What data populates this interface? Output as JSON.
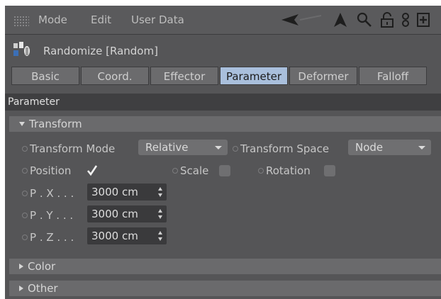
{
  "menu": {
    "items": [
      "Mode",
      "Edit",
      "User Data"
    ]
  },
  "object": {
    "name": "Randomize [Random]"
  },
  "tabs": [
    {
      "label": "Basic",
      "active": false
    },
    {
      "label": "Coord.",
      "active": false
    },
    {
      "label": "Effector",
      "active": false
    },
    {
      "label": "Parameter",
      "active": true
    },
    {
      "label": "Deformer",
      "active": false
    },
    {
      "label": "Falloff",
      "active": false
    }
  ],
  "section": {
    "title": "Parameter"
  },
  "groups": {
    "transform": "Transform",
    "color": "Color",
    "other": "Other"
  },
  "transform": {
    "mode_label": "Transform Mode",
    "mode_value": "Relative",
    "space_label": "Transform Space",
    "space_value": "Node",
    "position_label": "Position",
    "position_checked": true,
    "scale_label": "Scale",
    "scale_checked": false,
    "rotation_label": "Rotation",
    "rotation_checked": false,
    "px_label": "P . X . . .",
    "px_value": "3000 cm",
    "py_label": "P . Y . . .",
    "py_value": "3000 cm",
    "pz_label": "P . Z . . .",
    "pz_value": "3000 cm"
  },
  "colors": {
    "active_tab": "#a9bfdc",
    "panel": "#555557",
    "field": "#3a3a3c"
  },
  "icons": [
    "grip-icon",
    "back-arrow-icon",
    "pointer-icon",
    "search-icon",
    "lock-icon",
    "link-icon",
    "new-window-icon",
    "randomize-object-icon"
  ]
}
